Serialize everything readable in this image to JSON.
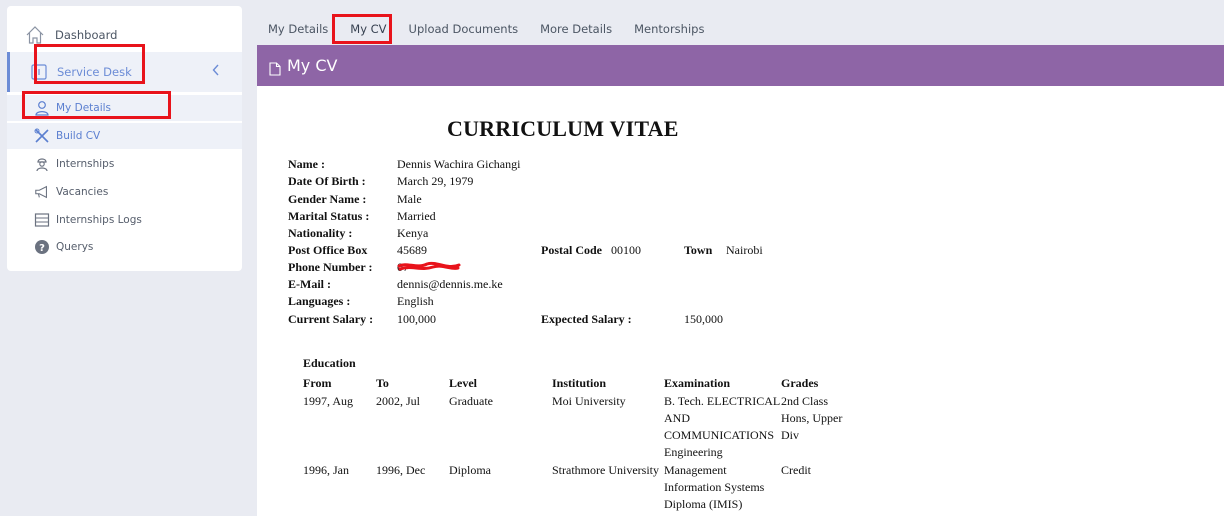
{
  "sidebar": {
    "dashboard": "Dashboard",
    "service_desk": "Service Desk",
    "items": [
      {
        "label": "My Details",
        "icon": "user-icon"
      },
      {
        "label": "Build CV",
        "icon": "tools-icon"
      },
      {
        "label": "Internships",
        "icon": "worker-icon"
      },
      {
        "label": "Vacancies",
        "icon": "megaphone-icon"
      },
      {
        "label": "Internships Logs",
        "icon": "table-icon"
      },
      {
        "label": "Querys",
        "icon": "question-icon"
      }
    ]
  },
  "tabs": [
    "My Details",
    "My CV",
    "Upload Documents",
    "More Details",
    "Mentorships"
  ],
  "panel": {
    "title": "My CV"
  },
  "cv": {
    "title": "CURRICULUM VITAE",
    "fields": {
      "name_label": "Name :",
      "name": "Dennis Wachira Gichangi",
      "dob_label": "Date Of Birth :",
      "dob": "March 29, 1979",
      "gender_label": "Gender Name :",
      "gender": "Male",
      "marital_label": "Marital Status :",
      "marital": "Married",
      "nationality_label": "Nationality :",
      "nationality": "Kenya",
      "pobox_label": "Post Office Box",
      "pobox": "45689",
      "postal_label": "Postal Code",
      "postal": "00100",
      "town_label": "Town",
      "town": "Nairobi",
      "phone_label": "Phone Number :",
      "phone": "07",
      "email_label": "E-Mail :",
      "email": "dennis@dennis.me.ke",
      "languages_label": "Languages :",
      "languages": "English",
      "salary_label": "Current Salary :",
      "salary": "100,000",
      "expected_label": "Expected Salary :",
      "expected": "150,000"
    },
    "education": {
      "title": "Education",
      "headers": [
        "From",
        "To",
        "Level",
        "Institution",
        "Examination",
        "Grades"
      ],
      "rows": [
        {
          "from": "1997, Aug",
          "to": "2002, Jul",
          "level": "Graduate",
          "institution": "Moi University",
          "exam": [
            "B. Tech. ELECTRICAL",
            "AND",
            "COMMUNICATIONS",
            "Engineering"
          ],
          "grades": [
            "2nd Class",
            "Hons, Upper",
            "Div"
          ]
        },
        {
          "from": "1996, Jan",
          "to": "1996, Dec",
          "level": "Diploma",
          "institution": "Strathmore University",
          "exam": [
            "Management",
            "Information Systems",
            "Diploma (IMIS)"
          ],
          "grades": [
            "Credit"
          ]
        }
      ]
    }
  },
  "colors": {
    "accent": "#8e65a6",
    "link": "#6c8cd6",
    "highlight": "#e8131b"
  }
}
